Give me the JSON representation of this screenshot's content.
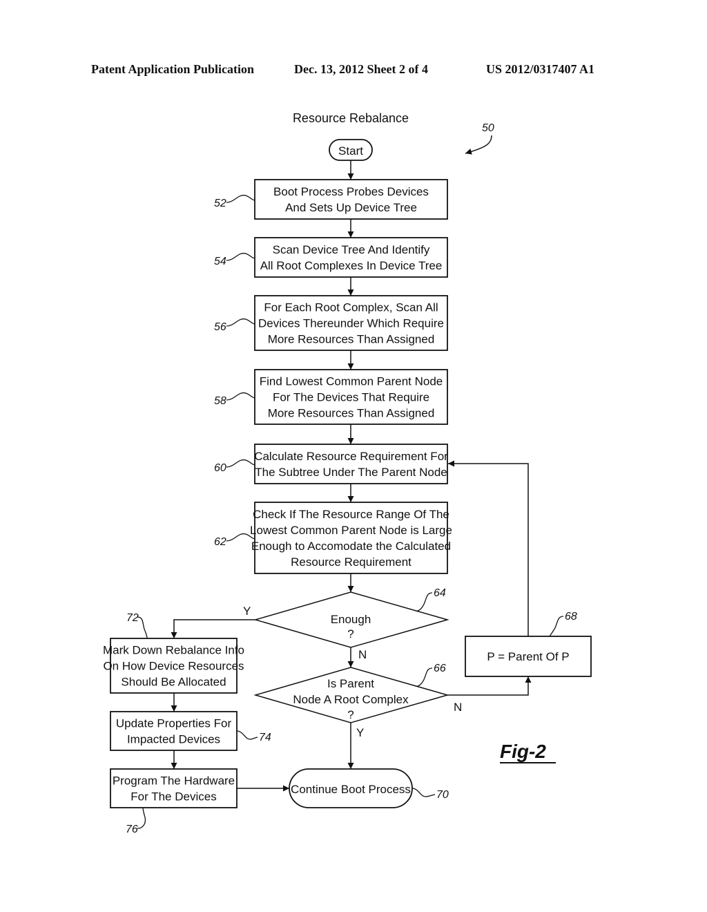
{
  "header": {
    "publication": "Patent Application Publication",
    "date_sheet": "Dec. 13, 2012   Sheet 2 of 4",
    "patent_number": "US 2012/0317407 A1"
  },
  "diagram": {
    "title": "Resource Rebalance",
    "figure_ref": "50",
    "figure_label": "Fig-2",
    "start": {
      "label": "Start"
    },
    "steps": {
      "s52": {
        "ref": "52",
        "lines": [
          "Boot Process Probes Devices",
          "And Sets Up Device Tree"
        ]
      },
      "s54": {
        "ref": "54",
        "lines": [
          "Scan Device Tree And Identify",
          "All Root Complexes In Device Tree"
        ]
      },
      "s56": {
        "ref": "56",
        "lines": [
          "For Each Root Complex, Scan All",
          "Devices Thereunder Which Require",
          "More Resources Than Assigned"
        ]
      },
      "s58": {
        "ref": "58",
        "lines": [
          "Find Lowest Common Parent Node",
          "For The Devices That Require",
          "More Resources Than Assigned"
        ]
      },
      "s60": {
        "ref": "60",
        "lines": [
          "Calculate Resource Requirement For",
          "The Subtree Under The Parent Node"
        ]
      },
      "s62": {
        "ref": "62",
        "lines": [
          "Check If The Resource Range Of The",
          "Lowest Common Parent Node is Large",
          "Enough to Accomodate the Calculated",
          "Resource Requirement"
        ]
      },
      "d64": {
        "ref": "64",
        "lines": [
          "Enough",
          "?"
        ]
      },
      "d66": {
        "ref": "66",
        "lines": [
          "Is Parent",
          "Node A Root Complex",
          "?"
        ]
      },
      "s68": {
        "ref": "68",
        "lines": [
          "P = Parent Of P"
        ]
      },
      "s70": {
        "ref": "70",
        "lines": [
          "Continue Boot Process"
        ]
      },
      "s72": {
        "ref": "72",
        "lines": [
          "Mark Down Rebalance Info",
          "On How Device Resources",
          "Should Be Allocated"
        ]
      },
      "s74": {
        "ref": "74",
        "lines": [
          "Update Properties For",
          "Impacted Devices"
        ]
      },
      "s76": {
        "ref": "76",
        "lines": [
          "Program The Hardware",
          "For The Devices"
        ]
      }
    },
    "branch_labels": {
      "d64_yes": "Y",
      "d64_no": "N",
      "d66_yes": "Y",
      "d66_no": "N"
    }
  }
}
